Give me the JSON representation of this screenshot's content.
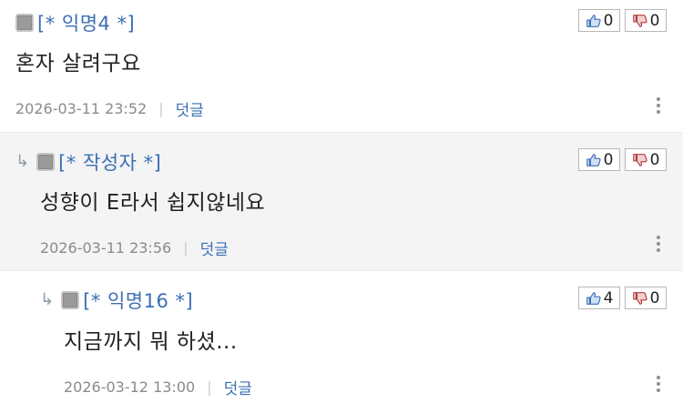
{
  "comments": [
    {
      "author": "[* 익명4 *]",
      "text": "혼자 살려구요",
      "date": "2026-03-11 23:52",
      "separator": "|",
      "reply_label": "덧글",
      "likes": "0",
      "dislikes": "0"
    },
    {
      "reply_marker": "↳",
      "author": "[* 작성자 *]",
      "text": "성향이 E라서 쉽지않네요",
      "date": "2026-03-11 23:56",
      "separator": "|",
      "reply_label": "덧글",
      "likes": "0",
      "dislikes": "0"
    },
    {
      "reply_marker": "↳",
      "author": "[* 익명16 *]",
      "text": "지금까지 뭐 하셨...",
      "date": "2026-03-12 13:00",
      "separator": "|",
      "reply_label": "덧글",
      "likes": "4",
      "dislikes": "0"
    }
  ],
  "icons": {
    "like": "thumbs-up-icon",
    "dislike": "thumbs-down-icon",
    "more": "more-vertical-icon",
    "avatar": "avatar-icon"
  },
  "colors": {
    "author": "#3b6fb4",
    "reply_link": "#3b6fb4",
    "meta": "#8a8a8a",
    "reply_background": "#f4f4f4"
  }
}
